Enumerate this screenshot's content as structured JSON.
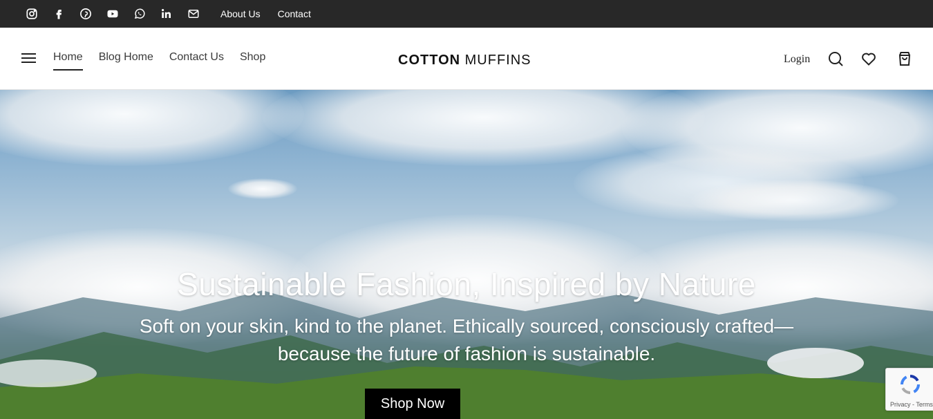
{
  "topbar": {
    "social_icons": [
      "instagram-icon",
      "facebook-icon",
      "pinterest-icon",
      "youtube-icon",
      "whatsapp-icon",
      "linkedin-icon",
      "email-icon"
    ],
    "links": [
      "About Us",
      "Contact"
    ]
  },
  "header": {
    "nav": [
      "Home",
      "Blog Home",
      "Contact Us",
      "Shop"
    ],
    "active_nav": "Home",
    "logo_bold": "COTTON",
    "logo_thin": "MUFFINS",
    "login_label": "Login",
    "icons": [
      "search-icon",
      "heart-icon",
      "cart-icon"
    ]
  },
  "hero": {
    "title": "Sustainable Fashion, Inspired by Nature",
    "subtitle": "Soft on your skin, kind to the planet. Ethically sourced, consciously crafted—because the future of fashion is sustainable.",
    "button_label": "Shop Now"
  },
  "recaptcha": {
    "text": "Privacy - Terms"
  },
  "colors": {
    "topbar_bg": "#282828",
    "button_bg": "#000000",
    "text_dark": "#222222"
  }
}
